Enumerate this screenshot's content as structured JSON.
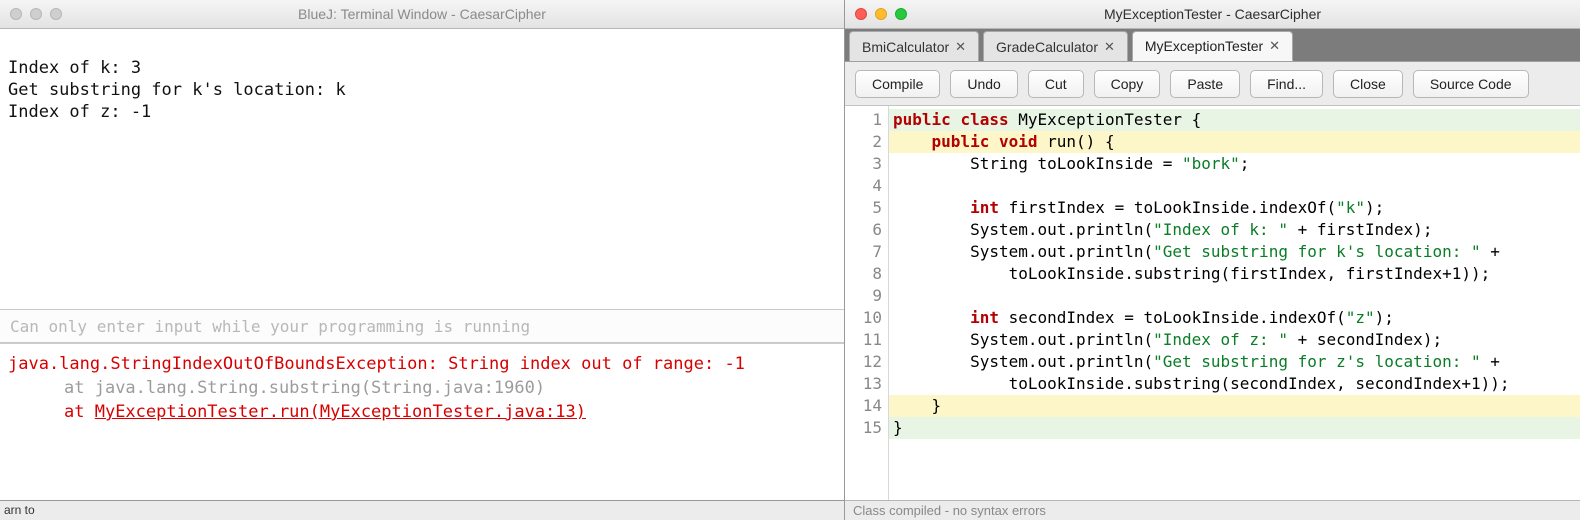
{
  "terminal": {
    "title": "BlueJ: Terminal Window - CaesarCipher",
    "output_lines": [
      "Index of k: 3",
      "Get substring for k's location: k",
      "Index of z: -1"
    ],
    "input_placeholder": "Can only enter input while your programming is running",
    "error_lines": {
      "main": "java.lang.StringIndexOutOfBoundsException: String index out of range: -1",
      "stack1_prefix": "at ",
      "stack1": "java.lang.String.substring(String.java:1960)",
      "stack2_prefix": "at ",
      "stack2": "MyExceptionTester.run(MyExceptionTester.java:13)"
    },
    "bottom_strip": "arn to"
  },
  "editor": {
    "title": "MyExceptionTester - CaesarCipher",
    "tabs": [
      {
        "label": "BmiCalculator",
        "active": false
      },
      {
        "label": "GradeCalculator",
        "active": false
      },
      {
        "label": "MyExceptionTester",
        "active": true
      }
    ],
    "toolbar": [
      "Compile",
      "Undo",
      "Cut",
      "Copy",
      "Paste",
      "Find...",
      "Close",
      "Source Code"
    ],
    "line_numbers": [
      "1",
      "2",
      "3",
      "4",
      "5",
      "6",
      "7",
      "8",
      "9",
      "10",
      "11",
      "12",
      "13",
      "14",
      "15"
    ],
    "code": {
      "l1_kw1": "public",
      "l1_kw2": "class",
      "l1_name": "MyExceptionTester",
      "l1_brace": "{",
      "l2_kw1": "public",
      "l2_kw2": "void",
      "l2_rest": "run() {",
      "l3": "        String toLookInside = ",
      "l3_str": "\"bork\"",
      "l3_end": ";",
      "l4": "",
      "l5a": "        ",
      "l5_kw": "int",
      "l5b": " firstIndex = toLookInside.indexOf(",
      "l5_str": "\"k\"",
      "l5c": ");",
      "l6a": "        System.out.println(",
      "l6_str": "\"Index of k: \"",
      "l6b": " + firstIndex);",
      "l7a": "        System.out.println(",
      "l7_str": "\"Get substring for k's location: \"",
      "l7b": " +",
      "l8": "            toLookInside.substring(firstIndex, firstIndex+1));",
      "l9": "",
      "l10a": "        ",
      "l10_kw": "int",
      "l10b": " secondIndex = toLookInside.indexOf(",
      "l10_str": "\"z\"",
      "l10c": ");",
      "l11a": "        System.out.println(",
      "l11_str": "\"Index of z: \"",
      "l11b": " + secondIndex);",
      "l12a": "        System.out.println(",
      "l12_str": "\"Get substring for z's location: \"",
      "l12b": " +",
      "l13": "            toLookInside.substring(secondIndex, secondIndex+1));",
      "l14": "    }",
      "l15": "}"
    },
    "status_footer": "Class compiled - no syntax errors"
  }
}
